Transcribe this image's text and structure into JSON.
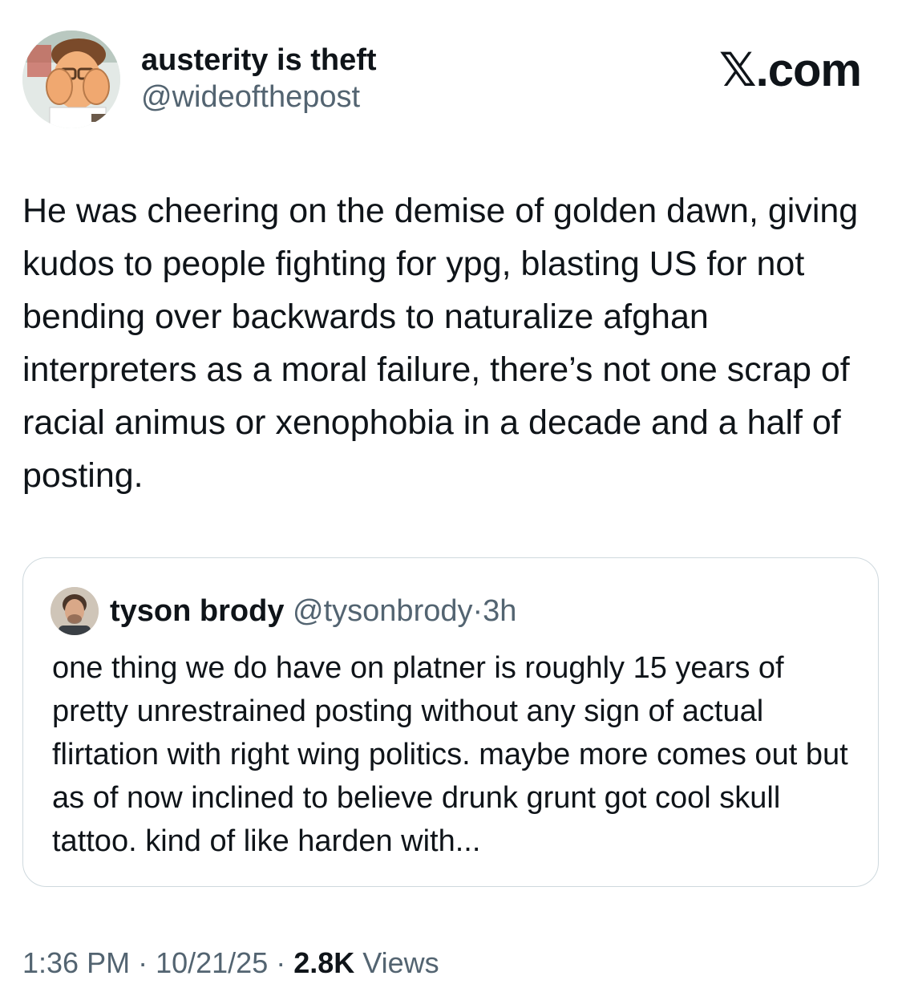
{
  "author": {
    "display_name": "austerity is theft",
    "handle": "@wideofthepost",
    "avatar_icon": "cartoon-face-palm-avatar"
  },
  "brand": {
    "logo_text": "𝕏.com"
  },
  "tweet": {
    "text": "He was cheering on the demise of golden dawn, giving kudos to people fighting for ypg, blasting US for not bending over backwards to naturalize afghan interpreters as a moral failure, there’s not one scrap of racial animus or xenophobia in a decade and a half of posting."
  },
  "quote": {
    "display_name": "tyson brody",
    "handle": "@tysonbrody",
    "separator": "·",
    "time": "3h",
    "avatar_icon": "profile-photo-avatar",
    "text": "one thing we do have on platner is roughly 15 years of pretty unrestrained posting without any sign of actual flirtation with right wing politics. maybe more comes out but as of now inclined to believe drunk grunt got cool skull tattoo. kind of like harden with..."
  },
  "meta": {
    "time": "1:36 PM",
    "separator1": " · ",
    "date": "10/21/25",
    "separator2": " · ",
    "views_count": "2.8K",
    "views_label": " Views"
  },
  "colors": {
    "text_primary": "#0f1419",
    "text_secondary": "#536471",
    "border": "#cfd9de",
    "background": "#ffffff"
  }
}
